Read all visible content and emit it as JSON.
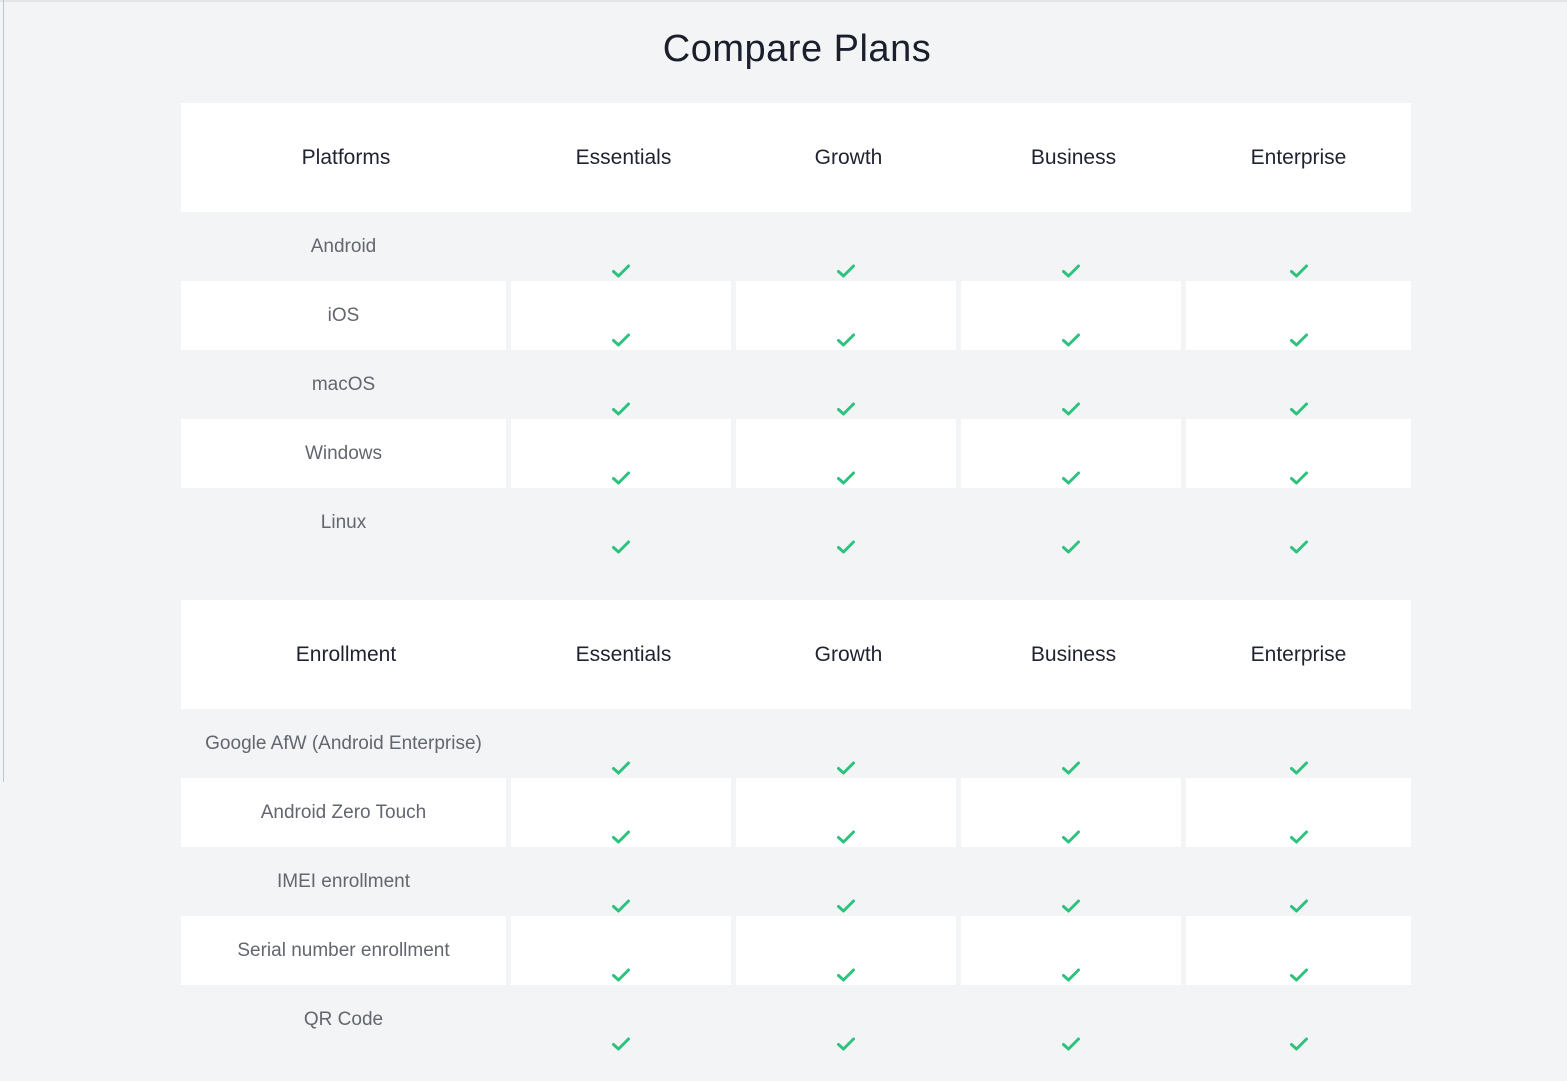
{
  "page": {
    "title": "Compare Plans"
  },
  "colors": {
    "check": "#2ec27e",
    "row_alt": "#f3f4f6",
    "row": "#ffffff"
  },
  "plans": [
    "Essentials",
    "Growth",
    "Business",
    "Enterprise"
  ],
  "sections": [
    {
      "header": "Platforms",
      "features": [
        {
          "name": "Android",
          "included": [
            true,
            true,
            true,
            true
          ]
        },
        {
          "name": "iOS",
          "included": [
            true,
            true,
            true,
            true
          ]
        },
        {
          "name": "macOS",
          "included": [
            true,
            true,
            true,
            true
          ]
        },
        {
          "name": "Windows",
          "included": [
            true,
            true,
            true,
            true
          ]
        },
        {
          "name": "Linux",
          "included": [
            true,
            true,
            true,
            true
          ]
        }
      ]
    },
    {
      "header": "Enrollment",
      "features": [
        {
          "name": "Google AfW (Android Enterprise)",
          "included": [
            true,
            true,
            true,
            true
          ]
        },
        {
          "name": "Android Zero Touch",
          "included": [
            true,
            true,
            true,
            true
          ]
        },
        {
          "name": "IMEI enrollment",
          "included": [
            true,
            true,
            true,
            true
          ]
        },
        {
          "name": "Serial number enrollment",
          "included": [
            true,
            true,
            true,
            true
          ]
        },
        {
          "name": "QR Code",
          "included": [
            true,
            true,
            true,
            true
          ]
        }
      ]
    }
  ]
}
